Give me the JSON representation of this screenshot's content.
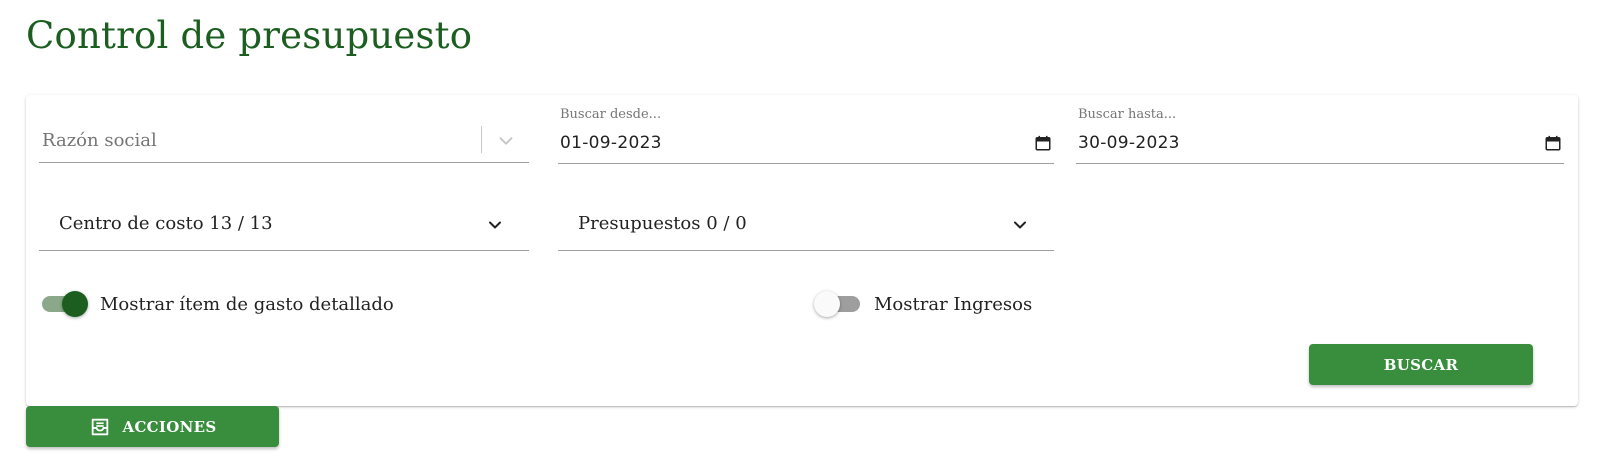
{
  "page": {
    "title": "Control de presupuesto"
  },
  "filters": {
    "razon_social": {
      "placeholder": "Razón social",
      "icon": "chevron-down-icon"
    },
    "fecha_desde": {
      "label": "Buscar desde...",
      "value": "01-09-2023",
      "icon": "calendar-icon"
    },
    "fecha_hasta": {
      "label": "Buscar hasta...",
      "value": "30-09-2023",
      "icon": "calendar-icon"
    },
    "centro_costo": {
      "label": "Centro de costo 13 / 13",
      "icon": "chevron-down-icon"
    },
    "presupuestos": {
      "label": "Presupuestos 0 / 0",
      "icon": "chevron-down-icon"
    }
  },
  "toggles": {
    "detalle": {
      "label": "Mostrar ítem de gasto detallado",
      "checked": true
    },
    "ingresos": {
      "label": "Mostrar Ingresos",
      "checked": false
    }
  },
  "actions": {
    "buscar_label": "BUSCAR",
    "acciones_label": "ACCIONES",
    "acciones_icon": "inbox-tray-icon"
  },
  "colors": {
    "title": "#1b5e20",
    "primary_button": "#388e3c",
    "switch_on_thumb": "#1b5e20",
    "switch_on_track": "#8aa98b",
    "switch_off_track": "#9e9e9e"
  }
}
